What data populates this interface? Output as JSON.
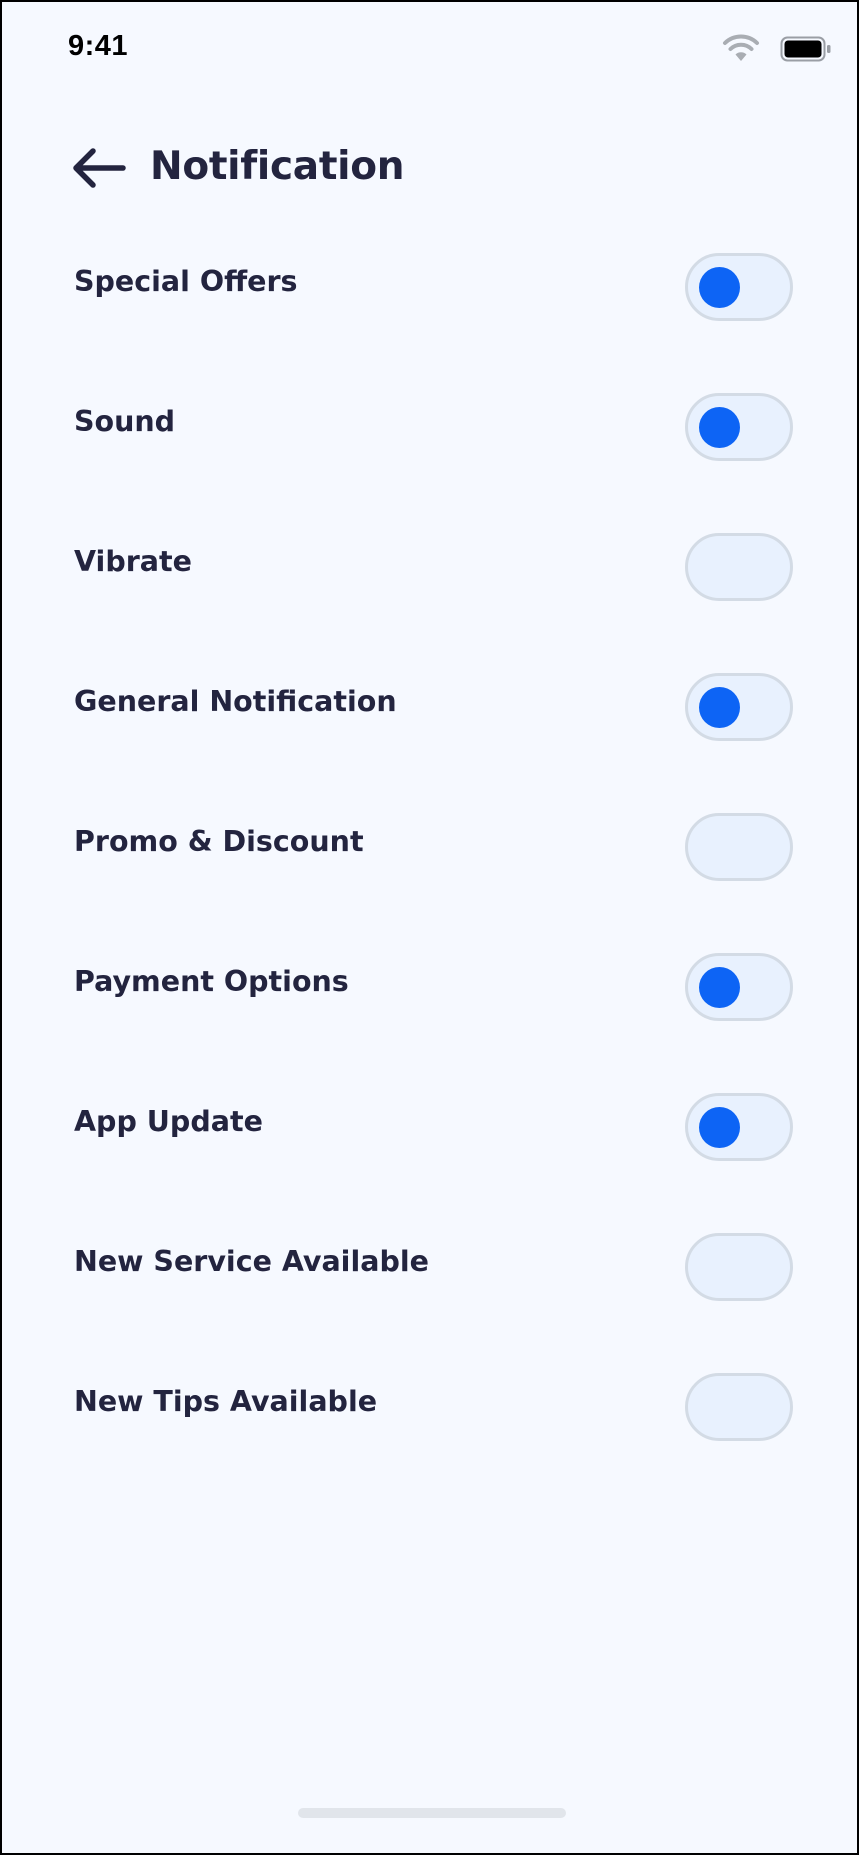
{
  "status_bar": {
    "time": "9:41",
    "icons": [
      "wifi-icon",
      "battery-icon"
    ]
  },
  "header": {
    "back_icon": "arrow-left-icon",
    "title": "Notification"
  },
  "colors": {
    "background": "#f6f9ff",
    "text": "#23243f",
    "toggle_on_knob": "#0d64f5",
    "toggle_track": "#e8f1fe",
    "toggle_border": "#d3dbe5"
  },
  "settings": [
    {
      "label": "Special Offers",
      "enabled": true
    },
    {
      "label": "Sound",
      "enabled": true
    },
    {
      "label": "Vibrate",
      "enabled": false
    },
    {
      "label": "General Notification",
      "enabled": true
    },
    {
      "label": "Promo & Discount",
      "enabled": false
    },
    {
      "label": "Payment Options",
      "enabled": true
    },
    {
      "label": "App Update",
      "enabled": true
    },
    {
      "label": "New Service Available",
      "enabled": false
    },
    {
      "label": "New Tips Available",
      "enabled": false
    }
  ]
}
